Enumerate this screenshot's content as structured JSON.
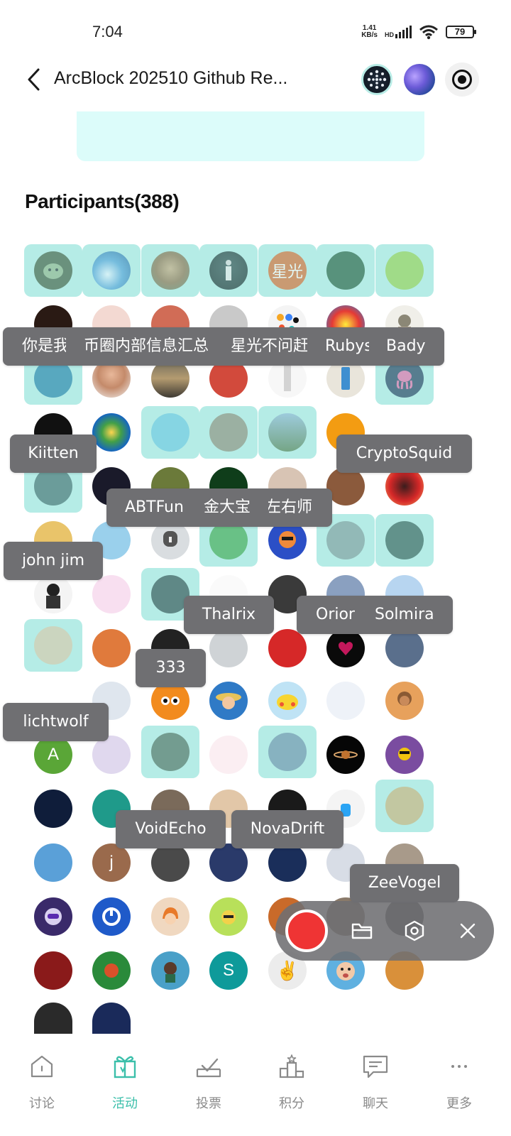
{
  "status_bar": {
    "time": "7:04",
    "net_speed": "1.41",
    "net_unit": "KB/s",
    "hd": "HD",
    "battery": "79"
  },
  "header": {
    "title": "ArcBlock 202510 Github Re..."
  },
  "participants": {
    "title": "Participants(388)"
  },
  "tooltips": [
    {
      "label": "你是我"
    },
    {
      "label": "币圈内部信息汇总"
    },
    {
      "label": "星光不问赶路人"
    },
    {
      "label": "Rubys"
    },
    {
      "label": "Bady"
    },
    {
      "label": "Kiitten"
    },
    {
      "label": "CryptoSquid"
    },
    {
      "label": "ABTFun"
    },
    {
      "label": "金大宝"
    },
    {
      "label": "左右师"
    },
    {
      "label": "john jim"
    },
    {
      "label": "Thalrix"
    },
    {
      "label": "Orior"
    },
    {
      "label": "Solmira"
    },
    {
      "label": "333"
    },
    {
      "label": "lichtwolf"
    },
    {
      "label": "VoidEcho"
    },
    {
      "label": "NovaDrift"
    },
    {
      "label": "ZeeVogel"
    }
  ],
  "avatar_texts": {
    "star": "星光",
    "a": "A",
    "j": "j",
    "s": "S"
  },
  "bottom_nav": [
    {
      "label": "讨论",
      "icon": "home-icon"
    },
    {
      "label": "活动",
      "icon": "gift-icon"
    },
    {
      "label": "投票",
      "icon": "vote-icon"
    },
    {
      "label": "积分",
      "icon": "podium-icon"
    },
    {
      "label": "聊天",
      "icon": "chat-icon"
    },
    {
      "label": "更多",
      "icon": "more-icon"
    }
  ],
  "colors": {
    "accent": "#3bbfaa",
    "highlight": "#b5ece6",
    "record": "#ef3434"
  }
}
